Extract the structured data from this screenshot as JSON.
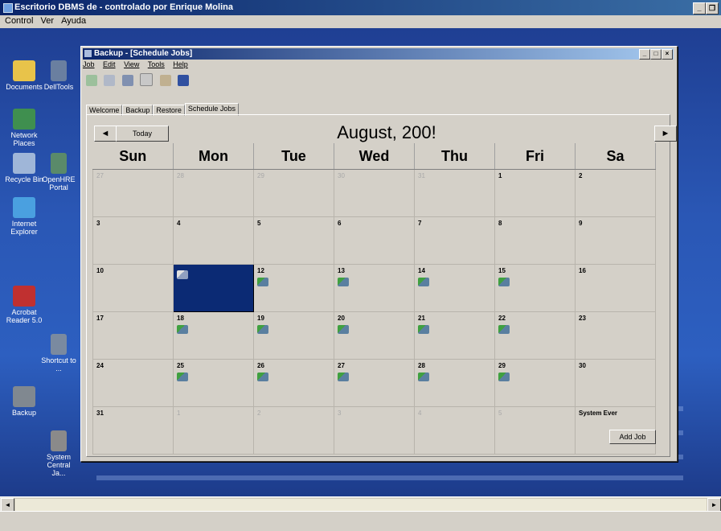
{
  "outer": {
    "title": "Escritorio DBMS de  - controlado por Enrique Molina",
    "menu": [
      "Control",
      "Ver",
      "Ayuda"
    ]
  },
  "desktop_icons": [
    "Documents",
    "Network Places",
    "Recycle Bin",
    "Internet Explorer",
    "Acrobat Reader 5.0",
    "Backup",
    "DellTools",
    "OpenHRE Portal",
    "Shortcut to ...",
    "System Central Ja..."
  ],
  "app": {
    "title": "Backup - [Schedule Jobs]",
    "menu": [
      "Job",
      "Edit",
      "View",
      "Tools",
      "Help"
    ],
    "tabs": [
      "Welcome",
      "Backup",
      "Restore",
      "Schedule Jobs"
    ],
    "active_tab": "Schedule Jobs",
    "today_button": "Today",
    "prev_label": "◄",
    "next_label": "►",
    "month_title": "August, 200!",
    "add_job_button": "Add Job",
    "weekdays": [
      "Sun",
      "Mon",
      "Tue",
      "Wed",
      "Thu",
      "Fri",
      "Sa"
    ],
    "weeks": [
      [
        {
          "d": "27",
          "o": true
        },
        {
          "d": "28",
          "o": true
        },
        {
          "d": "29",
          "o": true
        },
        {
          "d": "30",
          "o": true
        },
        {
          "d": "31",
          "o": true
        },
        {
          "d": "1"
        },
        {
          "d": "2"
        }
      ],
      [
        {
          "d": "3"
        },
        {
          "d": "4"
        },
        {
          "d": "5"
        },
        {
          "d": "6"
        },
        {
          "d": "7"
        },
        {
          "d": "8"
        },
        {
          "d": "9"
        }
      ],
      [
        {
          "d": "10"
        },
        {
          "d": "",
          "sel": true,
          "job": true
        },
        {
          "d": "12",
          "job": true
        },
        {
          "d": "13",
          "job": true
        },
        {
          "d": "14",
          "job": true
        },
        {
          "d": "15",
          "job": true
        },
        {
          "d": "16"
        }
      ],
      [
        {
          "d": "17"
        },
        {
          "d": "18",
          "job": true
        },
        {
          "d": "19",
          "job": true
        },
        {
          "d": "20",
          "job": true
        },
        {
          "d": "21",
          "job": true
        },
        {
          "d": "22",
          "job": true
        },
        {
          "d": "23"
        }
      ],
      [
        {
          "d": "24"
        },
        {
          "d": "25",
          "job": true
        },
        {
          "d": "26",
          "job": true
        },
        {
          "d": "27",
          "job": true
        },
        {
          "d": "28",
          "job": true
        },
        {
          "d": "29",
          "job": true
        },
        {
          "d": "30"
        }
      ],
      [
        {
          "d": "31"
        },
        {
          "d": "1",
          "o": true
        },
        {
          "d": "2",
          "o": true
        },
        {
          "d": "3",
          "o": true
        },
        {
          "d": "4",
          "o": true
        },
        {
          "d": "5",
          "o": true
        },
        {
          "d": "",
          "evt": "System Ever"
        }
      ]
    ]
  }
}
